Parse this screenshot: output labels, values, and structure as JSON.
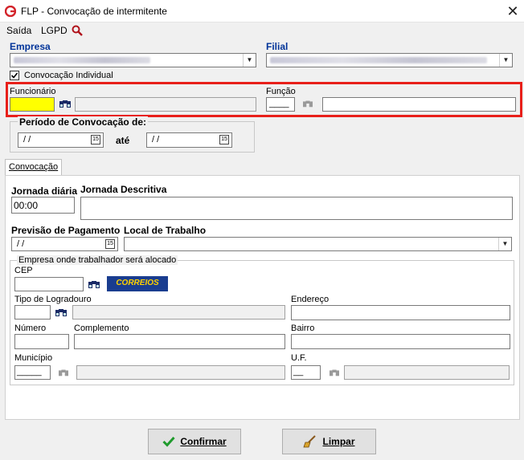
{
  "window": {
    "title": "FLP - Convocação de intermitente",
    "close": "✕"
  },
  "menu": {
    "saida": "Saída",
    "lgpd": "LGPD"
  },
  "empresa": {
    "label": "Empresa"
  },
  "filial": {
    "label": "Filial"
  },
  "convocacao_individual": {
    "label": "Convocação Individual",
    "checked": true
  },
  "funcionario": {
    "label": "Funcionário"
  },
  "funcao": {
    "label": "Função",
    "value": "____"
  },
  "periodo": {
    "label": "Período de Convocação de:",
    "from": " / /",
    "ate": "até",
    "to": " / /"
  },
  "tabs": [
    {
      "label": "Convocação"
    }
  ],
  "jornada_diaria": {
    "label": "Jornada diária",
    "value": "00:00"
  },
  "jornada_descritiva": {
    "label": "Jornada Descritiva"
  },
  "previsao_pagamento": {
    "label": "Previsão de Pagamento",
    "value": " / /"
  },
  "local_trabalho": {
    "label": "Local de Trabalho"
  },
  "empresa_alocado": {
    "label": "Empresa onde trabalhador será alocado",
    "cep": "CEP",
    "correios": "CORREIOS",
    "tipo_logradouro": "Tipo de Logradouro",
    "endereco": "Endereço",
    "numero": "Número",
    "complemento": "Complemento",
    "bairro": "Bairro",
    "municipio": "Município",
    "municipio_value": "_____",
    "uf": "U.F.",
    "uf_value": "__"
  },
  "buttons": {
    "confirmar": "Confirmar",
    "limpar": "Limpar"
  },
  "colors": {
    "accent_label": "#003399",
    "highlight_field": "#ffff00",
    "focus_frame": "#e8201a"
  }
}
